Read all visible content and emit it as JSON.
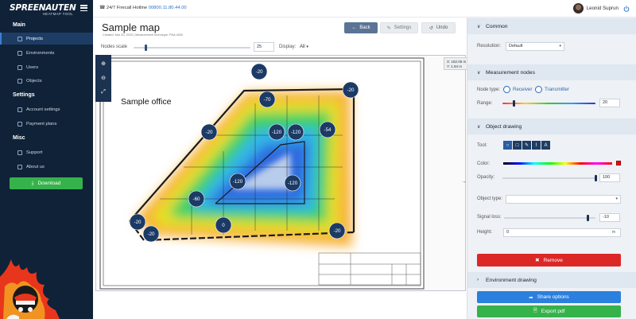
{
  "sidebar": {
    "brand": "SPREENAUTEN",
    "brand_sub": "HEATMAP TOOL",
    "sections": [
      {
        "title": "Main",
        "items": [
          {
            "label": "Projects"
          },
          {
            "label": "Environments"
          },
          {
            "label": "Users"
          },
          {
            "label": "Objects"
          }
        ]
      },
      {
        "title": "Settings",
        "items": [
          {
            "label": "Account settings"
          },
          {
            "label": "Payment plans"
          }
        ]
      },
      {
        "title": "Misc",
        "items": [
          {
            "label": "Support"
          },
          {
            "label": "About us"
          }
        ]
      }
    ],
    "active_item": "Projects",
    "download_label": "Download"
  },
  "topbar": {
    "hotline_label": "24/7 Firecall Hotline",
    "hotline_number": "00800.11.80.44.00",
    "user_name": "Leonid Suprun"
  },
  "page": {
    "title": "Sample map",
    "meta": "Created: Mar 20, 2020 | Measurement technique: PNA 4000",
    "back_label": "Back",
    "settings_label": "Settings",
    "undo_label": "Undo",
    "nodes_scale_label": "Nodes scale",
    "nodes_scale_value": "25",
    "display_label": "Display:",
    "display_value": "All",
    "map_label": "Sample office",
    "coords": {
      "x": "X: 182.05 m",
      "y": "Y: 1.94 m"
    },
    "nodes": [
      {
        "value": "-20",
        "color": "#1b3a66"
      },
      {
        "value": "-20",
        "color": "#1b3a66"
      },
      {
        "value": "-70",
        "color": "#1b3a66"
      },
      {
        "value": "-20",
        "color": "#1b3a66"
      },
      {
        "value": "-120",
        "color": "#1b3a66"
      },
      {
        "value": "-120",
        "color": "#1b3a66"
      },
      {
        "value": "-54",
        "color": "#1b3a66"
      },
      {
        "value": "-120",
        "color": "#1b3a66"
      },
      {
        "value": "-120",
        "color": "#1b3a66"
      },
      {
        "value": "-60",
        "color": "#1b3a66"
      },
      {
        "value": "-20",
        "color": "#1b3a66"
      },
      {
        "value": "-20",
        "color": "#1b3a66"
      },
      {
        "value": "0",
        "color": "#1b3a66"
      },
      {
        "value": "-20",
        "color": "#1b3a66"
      }
    ]
  },
  "panel": {
    "common": {
      "title": "Common",
      "resolution_label": "Resolution:",
      "resolution_value": "Default"
    },
    "measurement": {
      "title": "Measurement nodes",
      "node_type_label": "Node type:",
      "receiver_label": "Receiver",
      "transmitter_label": "Transmitter",
      "range_label": "Range:",
      "range_value": "20",
      "range_fraction": 0.12
    },
    "object_drawing": {
      "title": "Object drawing",
      "tool_label": "Tool:",
      "tools": [
        "circle-tool",
        "square-tool",
        "pen-tool",
        "wifi-tool",
        "text-tool"
      ],
      "color_label": "Color:",
      "color_value": "#ff0000",
      "opacity_label": "Opacity:",
      "opacity_value": "100",
      "opacity_fraction": 1.0,
      "object_type_label": "Object type:",
      "object_type_value": "",
      "signal_loss_label": "Signal loss:",
      "signal_loss_value": "-10",
      "signal_loss_fraction": 0.92,
      "height_label": "Height:",
      "height_value": "0",
      "height_unit": "m",
      "remove_label": "Remove"
    },
    "environment": {
      "title": "Environment drawing"
    },
    "share_label": "Share options",
    "export_label": "Export pdf"
  }
}
